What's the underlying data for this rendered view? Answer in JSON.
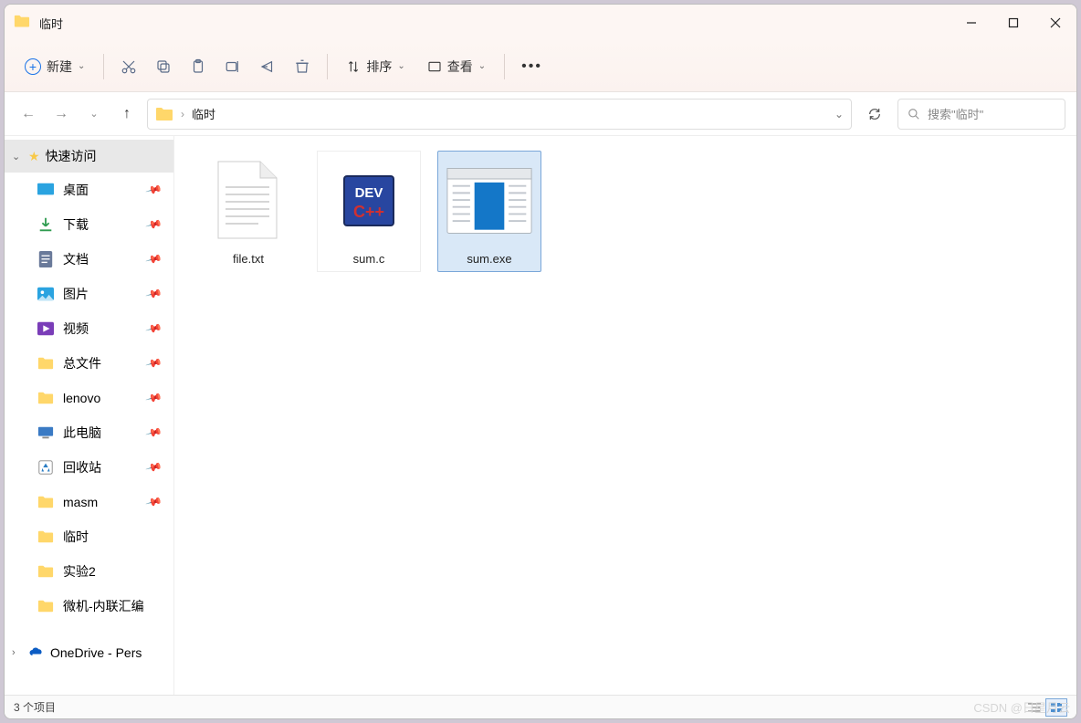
{
  "window": {
    "title": "临时"
  },
  "toolbar": {
    "new_label": "新建",
    "sort_label": "排序",
    "view_label": "查看"
  },
  "breadcrumb": {
    "current": "临时"
  },
  "search": {
    "placeholder": "搜索\"临时\""
  },
  "sidebar": {
    "quick_access": "快速访问",
    "items": [
      {
        "label": "桌面",
        "pinned": true,
        "icon": "desktop"
      },
      {
        "label": "下载",
        "pinned": true,
        "icon": "download"
      },
      {
        "label": "文档",
        "pinned": true,
        "icon": "document"
      },
      {
        "label": "图片",
        "pinned": true,
        "icon": "picture"
      },
      {
        "label": "视频",
        "pinned": true,
        "icon": "video"
      },
      {
        "label": "总文件",
        "pinned": true,
        "icon": "folder"
      },
      {
        "label": "lenovo",
        "pinned": true,
        "icon": "folder"
      },
      {
        "label": "此电脑",
        "pinned": true,
        "icon": "pc"
      },
      {
        "label": "回收站",
        "pinned": true,
        "icon": "recycle"
      },
      {
        "label": "masm",
        "pinned": true,
        "icon": "folder"
      },
      {
        "label": "临时",
        "pinned": false,
        "icon": "folder"
      },
      {
        "label": "实验2",
        "pinned": false,
        "icon": "folder"
      },
      {
        "label": "微机-内联汇编",
        "pinned": false,
        "icon": "folder"
      }
    ],
    "onedrive": "OneDrive - Pers"
  },
  "files": [
    {
      "name": "file.txt",
      "type": "text",
      "selected": false
    },
    {
      "name": "sum.c",
      "type": "devcpp",
      "selected": false
    },
    {
      "name": "sum.exe",
      "type": "exe",
      "selected": true
    }
  ],
  "status": {
    "count_text": "3 个项目"
  },
  "watermark": "CSDN @日星月云"
}
